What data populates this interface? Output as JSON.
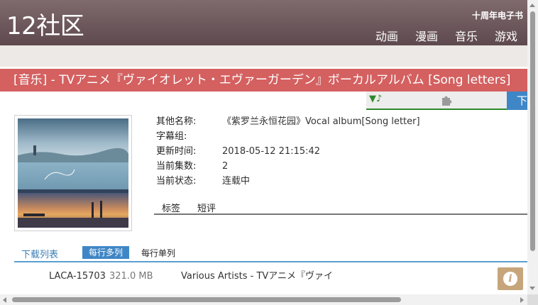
{
  "header": {
    "logo": "12社区",
    "anniversary_link": "十周年电子书",
    "nav": [
      "动画",
      "漫画",
      "音乐",
      "游戏"
    ]
  },
  "title": "[音乐] - TVアニメ『ヴァイオレット・エヴァーガーデン』ボーカルアルバム [Song letters]",
  "player": {
    "icon_text": "▼♪",
    "icon": "plugin-icon"
  },
  "download_button": "下",
  "info": [
    {
      "label": "其他名称:",
      "value": "《紫罗兰永恒花园》Vocal album[Song letter]"
    },
    {
      "label": "字幕组:",
      "value": ""
    },
    {
      "label": "更新时间:",
      "value": "2018-05-12 21:15:42"
    },
    {
      "label": "当前集数:",
      "value": "2"
    },
    {
      "label": "当前状态:",
      "value": "连载中"
    }
  ],
  "subtabs": [
    "标签",
    "短评"
  ],
  "download_list": {
    "title": "下载列表",
    "tab_active": "每行多列",
    "tab_other": "每行单列"
  },
  "file": {
    "code": "LACA-15703",
    "size": "321.0 MB",
    "name": "Various Artists - TVアニメ『ヴァイ"
  },
  "info_button": {
    "glyph": "i",
    "icon": "info-icon"
  },
  "colors": {
    "header": "#6b5559",
    "title_bar": "#d46060",
    "accent_blue": "#3f86c6",
    "player_green": "#2c8a2c",
    "info_button": "#c7a57b"
  }
}
